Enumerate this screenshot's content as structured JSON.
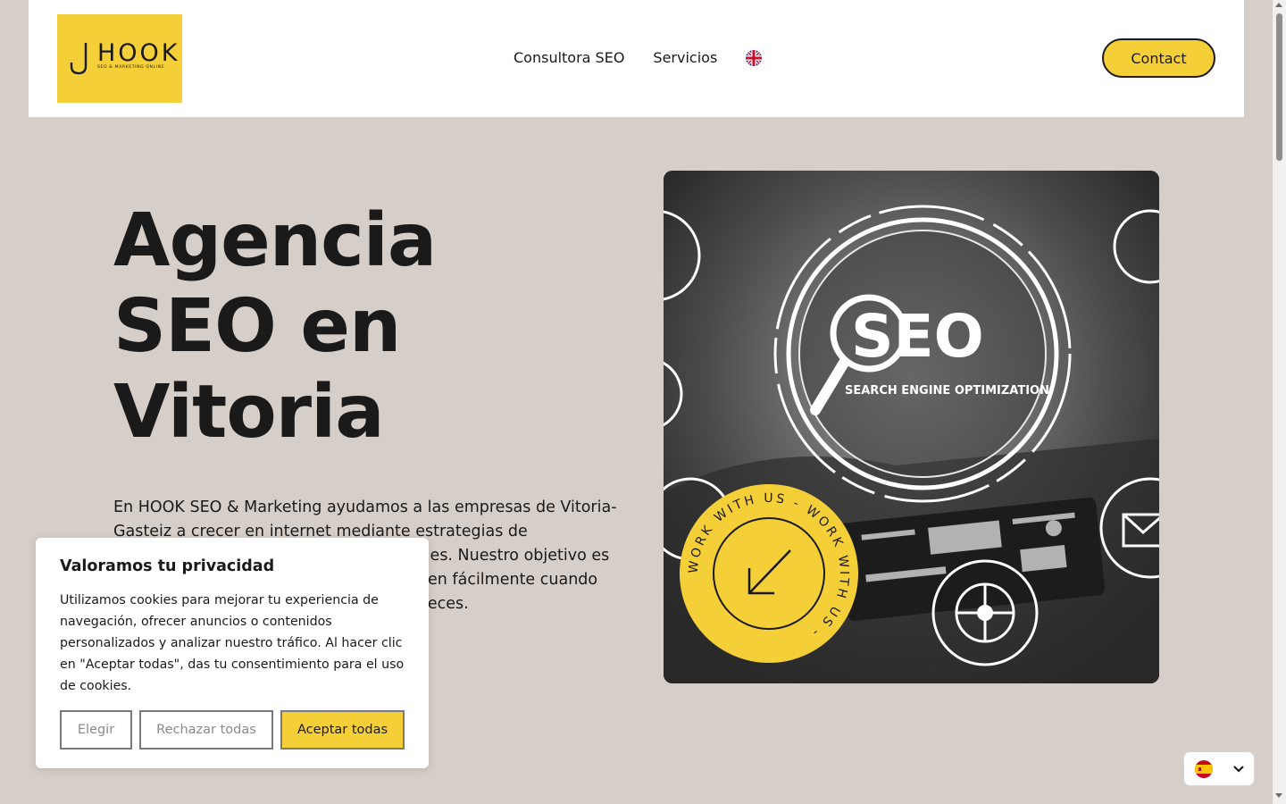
{
  "header": {
    "logo": {
      "word": "HOOK",
      "tagline": "SEO & MARKETING ONLINE"
    },
    "nav": [
      {
        "label": "Consultora SEO"
      },
      {
        "label": "Servicios"
      }
    ],
    "language_flag": "uk-flag-icon",
    "contact_label": "Contact"
  },
  "hero": {
    "title_lines": [
      "Agencia",
      "SEO en",
      "Vitoria"
    ],
    "description": "En HOOK SEO & Marketing ayudamos a las empresas de Vitoria-Gasteiz a crecer en internet mediante estrategias de posicionamiento SEO medibles y rentables. Nuestro objetivo es que tus clientes potenciales te encuentren fácilmente cuando buscan los productos o servicios que ofreces.",
    "image": {
      "seo_text": "SEO",
      "caption": "SEARCH ENGINE OPTIMIZATION",
      "badge_text": "WORK WITH US - WORK WITH US - "
    }
  },
  "cookie_banner": {
    "title": "Valoramos tu privacidad",
    "body": "Utilizamos cookies para mejorar tu experiencia de navegación, ofrecer anuncios o contenidos personalizados y analizar nuestro tráfico. Al hacer clic en \"Aceptar todas\", das tu consentimiento para el uso de cookies.",
    "buttons": {
      "choose": "Elegir",
      "reject": "Rechazar todas",
      "accept": "Aceptar todas"
    }
  },
  "language_switcher": {
    "current": "es-flag-icon"
  },
  "colors": {
    "brand_yellow": "#f5cf38",
    "page_bg": "#d6cec8",
    "text": "#1a1a1a"
  }
}
